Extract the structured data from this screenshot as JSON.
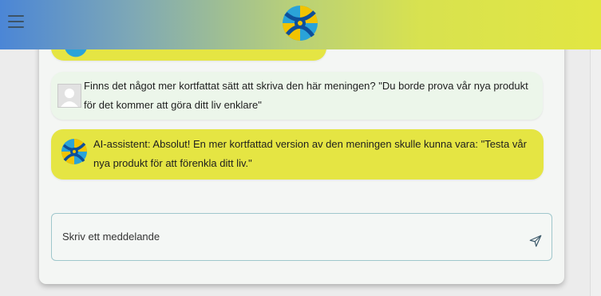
{
  "header": {
    "menu_icon": "hamburger-menu-icon",
    "logo_icon": "assistant-logo-icon",
    "colors": {
      "gradient_start": "#4b86d6",
      "gradient_end": "#e2e642"
    }
  },
  "chat": {
    "messages": [
      {
        "role": "assistant",
        "text": "",
        "avatar": "assistant-logo-icon",
        "partial": true
      },
      {
        "role": "user",
        "avatar": "user-avatar-icon",
        "text": "Finns det något mer kortfattat sätt att skriva den här meningen? \"Du borde prova vår nya produkt för det kommer att göra ditt liv enklare\""
      },
      {
        "role": "assistant",
        "avatar": "assistant-logo-icon",
        "text": "AI-assistent: Absolut! En mer kortfattad version av den meningen skulle kunna vara: \"Testa vår nya produkt för att förenkla ditt liv.\""
      }
    ],
    "colors": {
      "assistant_bubble": "#e5e543",
      "user_bubble": "#ecf6ea"
    }
  },
  "composer": {
    "placeholder": "Skriv ett meddelande",
    "value": "",
    "send_icon": "send-icon"
  }
}
